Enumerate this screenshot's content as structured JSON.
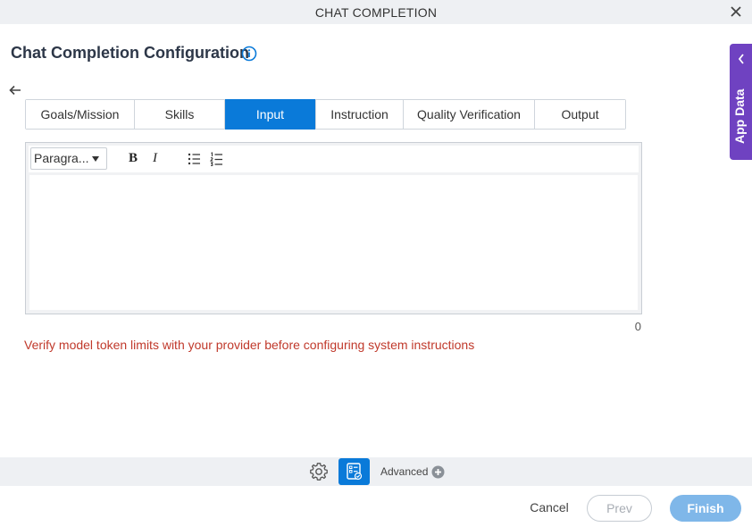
{
  "dialog": {
    "title": "CHAT COMPLETION",
    "close_icon": "close-icon"
  },
  "header": {
    "heading": "Chat Completion Configuration",
    "info_icon": "info-icon"
  },
  "nav": {
    "back_icon": "back-arrow-icon"
  },
  "tabs": [
    {
      "label": "Goals/Mission",
      "active": false
    },
    {
      "label": "Skills",
      "active": false
    },
    {
      "label": "Input",
      "active": true
    },
    {
      "label": "Instruction",
      "active": false
    },
    {
      "label": "Quality Verification",
      "active": false
    },
    {
      "label": "Output",
      "active": false
    }
  ],
  "editor": {
    "format_select": "Paragra...",
    "bold_label": "B",
    "italic_label": "I",
    "content": "",
    "char_count": "0"
  },
  "warning": "Verify model token limits with your provider before configuring system instructions",
  "side_panel": {
    "label": "App Data"
  },
  "footer": {
    "advanced_label": "Advanced",
    "cancel_label": "Cancel",
    "prev_label": "Prev",
    "finish_label": "Finish"
  },
  "colors": {
    "accent": "#0a7ad9",
    "side_tab": "#6f42c1",
    "warning": "#c0392b",
    "finish_disabled": "#7fb7e9"
  }
}
